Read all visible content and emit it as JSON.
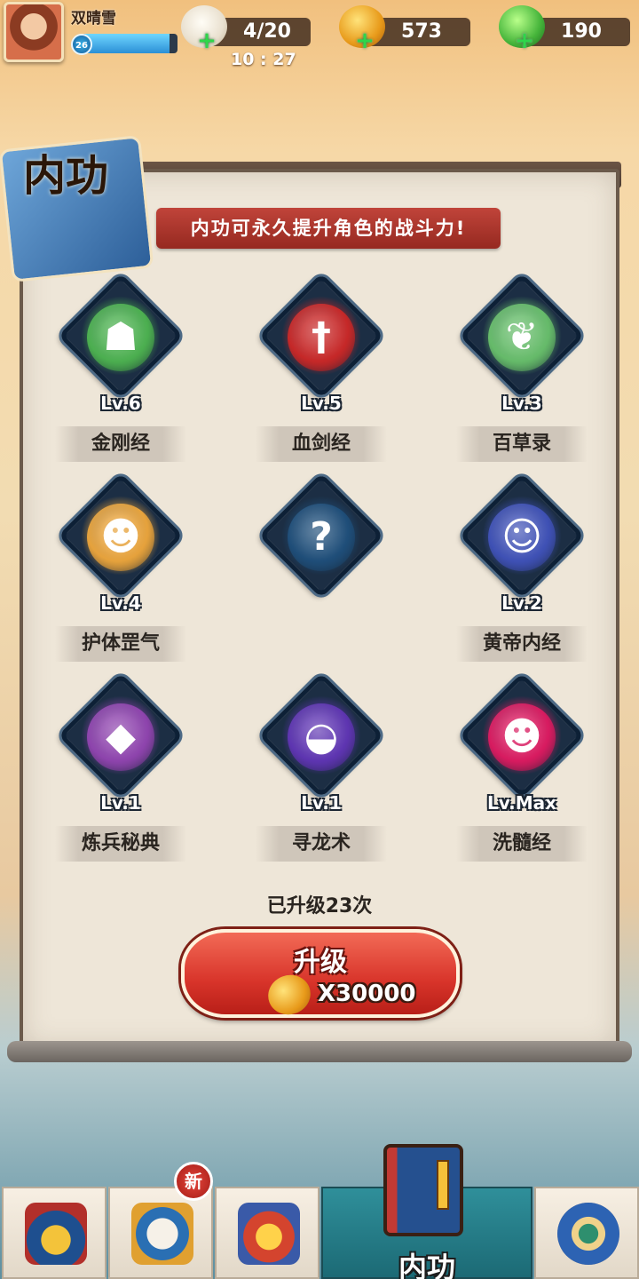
{
  "player": {
    "name": "双晴雪",
    "level": "26",
    "xp_fraction": 0.92
  },
  "resources": [
    {
      "icon": "bun-stamina-icon",
      "value": "4/20"
    },
    {
      "icon": "gold-leaf-icon",
      "value": "573"
    },
    {
      "icon": "jade-leaf-icon",
      "value": "190"
    }
  ],
  "timer": "10 : 27",
  "panel": {
    "title": "内功",
    "banner": "内功可永久提升角色的战斗力!"
  },
  "skills": [
    {
      "name": "金刚经",
      "level": "Lv.6",
      "icon": "muscle-figure-icon",
      "color": "#4caf50"
    },
    {
      "name": "血剑经",
      "level": "Lv.5",
      "icon": "blood-sword-icon",
      "color": "#c62828"
    },
    {
      "name": "百草录",
      "level": "Lv.3",
      "icon": "herb-leaf-icon",
      "color": "#66bb6a"
    },
    {
      "name": "护体罡气",
      "level": "Lv.4",
      "icon": "golden-body-icon",
      "color": "#e6a23c"
    },
    {
      "name": "",
      "level": "",
      "icon": "locked-question-icon",
      "color": "#1f4e79"
    },
    {
      "name": "黄帝内经",
      "level": "Lv.2",
      "icon": "meditating-figure-icon",
      "color": "#3f51b5"
    },
    {
      "name": "炼兵秘典",
      "level": "Lv.1",
      "icon": "anvil-icon",
      "color": "#8e44ad"
    },
    {
      "name": "寻龙术",
      "level": "Lv.1",
      "icon": "gold-ingot-icon",
      "color": "#5e35b1"
    },
    {
      "name": "洗髓经",
      "level": "Lv.Max",
      "icon": "red-figure-icon",
      "color": "#d81b60"
    }
  ],
  "upgrade": {
    "count_text": "已升级23次",
    "label": "升级",
    "cost": "X30000"
  },
  "nav": {
    "new_badge": "新",
    "tabs": [
      {
        "icon": "treasure-shop-icon",
        "label": ""
      },
      {
        "icon": "robe-armor-icon",
        "label": ""
      },
      {
        "icon": "weapon-icon",
        "label": ""
      },
      {
        "icon": "book-icon",
        "label": "内功"
      },
      {
        "icon": "settings-gear-icon",
        "label": ""
      }
    ]
  }
}
